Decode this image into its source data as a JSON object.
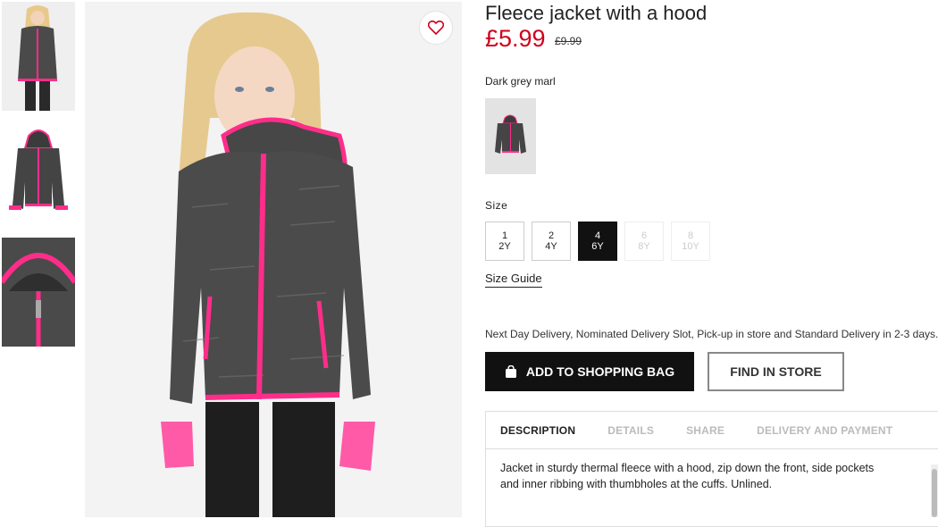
{
  "product": {
    "title": "Fleece jacket with a hood",
    "price": "£5.99",
    "old_price": "£9.99",
    "color_name": "Dark grey marl"
  },
  "colors": {
    "accent_pink": "#ff2d8a",
    "price_red": "#d0021b",
    "fleece_dark": "#3b3b3b"
  },
  "size": {
    "label": "Size",
    "options": [
      {
        "top": "1",
        "bottom": "2Y",
        "state": "available"
      },
      {
        "top": "2",
        "bottom": "4Y",
        "state": "available"
      },
      {
        "top": "4",
        "bottom": "6Y",
        "state": "selected"
      },
      {
        "top": "6",
        "bottom": "8Y",
        "state": "disabled"
      },
      {
        "top": "8",
        "bottom": "10Y",
        "state": "disabled"
      }
    ],
    "guide_label": "Size Guide"
  },
  "delivery_text": "Next Day Delivery, Nominated Delivery Slot, Pick-up in store and Standard Delivery in 2-3 days.",
  "actions": {
    "add_to_bag": "ADD TO SHOPPING BAG",
    "find_in_store": "FIND IN STORE"
  },
  "tabs": [
    {
      "label": "DESCRIPTION",
      "active": true
    },
    {
      "label": "DETAILS",
      "active": false
    },
    {
      "label": "SHARE",
      "active": false
    },
    {
      "label": "DELIVERY AND PAYMENT",
      "active": false
    }
  ],
  "description": "Jacket in sturdy thermal fleece with a hood, zip down the front, side pockets and inner ribbing with thumbholes at the cuffs. Unlined.",
  "icons": [
    "heart-icon",
    "shopping-bag-icon"
  ]
}
